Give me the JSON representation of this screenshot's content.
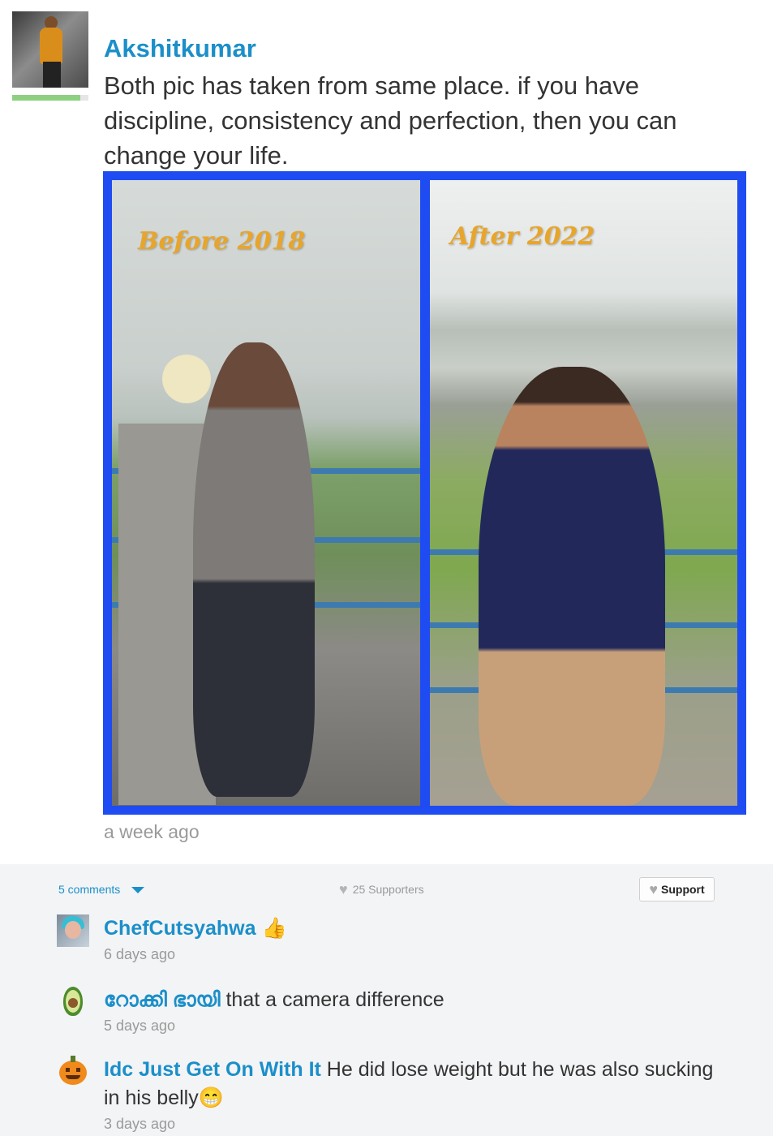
{
  "post": {
    "author": "Akshitkumar",
    "text": "Both pic has taken from same place. if you have discipline, consistency and perfection, then you can change your life.",
    "time": "a week ago",
    "image": {
      "left_label": "Before 2018",
      "right_label": "After 2022",
      "border_color": "#1e4cf2"
    },
    "avatar_icon": "user-photo-avatar",
    "level_progress": 0.89
  },
  "meta": {
    "comments_count": "5 comments",
    "supporters": "25 Supporters",
    "support_label": "Support",
    "heart_icon": "heart-icon",
    "chevron_icon": "chevron-down-icon"
  },
  "comments": [
    {
      "author": "ChefCutsyahwa",
      "text": "👍",
      "time": "6 days ago",
      "avatar_icon": "user-photo-avatar"
    },
    {
      "author": "റോക്കി ഭായി",
      "text": "that a camera difference",
      "time": "5 days ago",
      "avatar_icon": "avocado-icon"
    },
    {
      "author": "Idc Just Get On With It",
      "text": "He did lose weight but he was also sucking in his belly😁",
      "time": "3 days ago",
      "avatar_icon": "pumpkin-icon"
    }
  ],
  "colors": {
    "accent": "#1b8fc9",
    "muted": "#9a9a9a",
    "level_bar": "#8ed081",
    "comments_bg": "#f3f4f6"
  }
}
